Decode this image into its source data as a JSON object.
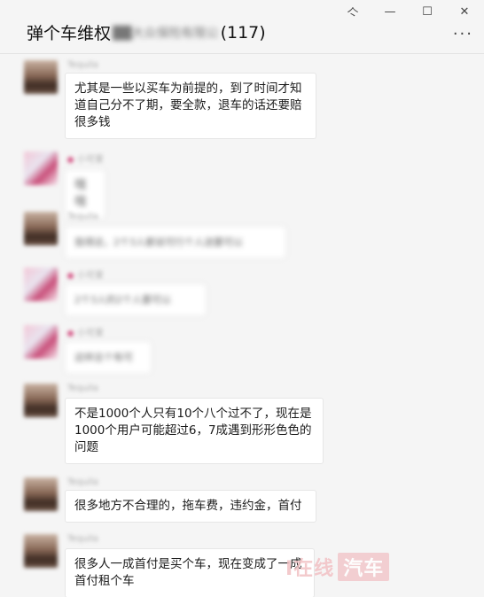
{
  "window": {
    "pin": "亽",
    "minimize": "—",
    "maximize": "☐",
    "close": "✕"
  },
  "header": {
    "title": "弹个车维权",
    "title_blurred": "██大众保险有限公",
    "member_count": "(117)",
    "more": "···"
  },
  "messages": [
    {
      "nickname": "Tequila",
      "avatar": "photo",
      "text": "尤其是一些以买车为前提的，到了时间才知道自己分不了期，要全款，退车的话还要赔很多钱",
      "blurred": false
    },
    {
      "nickname": "小可爱",
      "avatar": "pink",
      "text": "哦哦",
      "blurred": true
    },
    {
      "nickname": "Tequila",
      "avatar": "photo",
      "text": "我得这，2个3人都说可行个人送要可以",
      "blurred": true
    },
    {
      "nickname": "小可爱",
      "avatar": "pink",
      "text": "2个3人的2个人要可以",
      "blurred": true
    },
    {
      "nickname": "小可爱",
      "avatar": "pink",
      "text": "这样总个有可",
      "blurred": true
    },
    {
      "nickname": "Tequila",
      "avatar": "photo",
      "text": "不是1000个人只有10个八个过不了，现在是1000个用户可能超过6，7成遇到形形色色的问题",
      "blurred": false
    },
    {
      "nickname": "Tequila",
      "avatar": "photo",
      "text": "很多地方不合理的，拖车费，违约金，首付",
      "blurred": false
    },
    {
      "nickname": "Tequila",
      "avatar": "photo",
      "text": "很多人一成首付是买个车，现在变成了一成首付租个车",
      "blurred": false
    }
  ],
  "watermark": {
    "text": "I在线",
    "badge": "汽车"
  }
}
